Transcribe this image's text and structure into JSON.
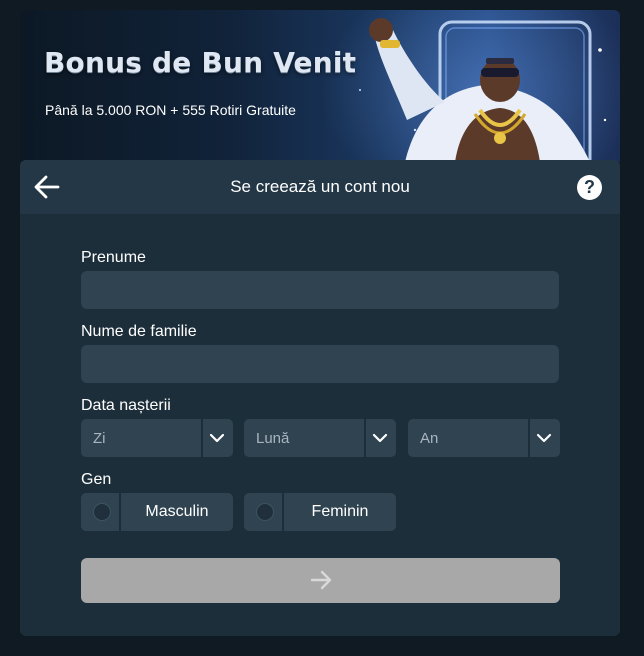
{
  "banner": {
    "title": "Bonus de Bun Venit",
    "subtitle": "Până la 5.000 RON + 555 Rotiri Gratuite"
  },
  "header": {
    "title": "Se creează un cont nou",
    "back_icon": "arrow-left-icon",
    "help_icon": "question-circle-icon",
    "help_glyph": "?"
  },
  "form": {
    "first_name": {
      "label": "Prenume",
      "value": "",
      "placeholder": ""
    },
    "last_name": {
      "label": "Nume de familie",
      "value": "",
      "placeholder": ""
    },
    "birth_date": {
      "label": "Data nașterii",
      "day": "Zi",
      "month": "Lună",
      "year": "An"
    },
    "gender": {
      "label": "Gen",
      "options": [
        "Masculin",
        "Feminin"
      ]
    },
    "submit_icon": "arrow-right-icon"
  },
  "colors": {
    "page_bg": "#0f1a22",
    "card_bg": "#1d2e3b",
    "header_bg": "#233746",
    "input_bg": "#2f4350",
    "submit_disabled": "#a8a8a8"
  }
}
